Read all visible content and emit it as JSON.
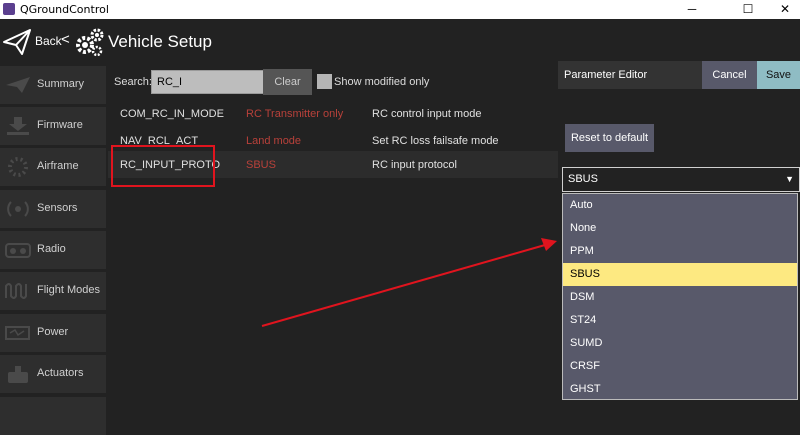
{
  "window": {
    "title": "QGroundControl",
    "controls": [
      "─",
      "☐",
      "✕"
    ]
  },
  "toolbar": {
    "back_label": "Back",
    "separator": "<",
    "title": "Vehicle Setup"
  },
  "sidebar": {
    "items": [
      {
        "label": "Summary",
        "icon": "plane-icon"
      },
      {
        "label": "Firmware",
        "icon": "download-icon"
      },
      {
        "label": "Airframe",
        "icon": "airframe-icon"
      },
      {
        "label": "Sensors",
        "icon": "sensors-icon"
      },
      {
        "label": "Radio",
        "icon": "radio-icon"
      },
      {
        "label": "Flight Modes",
        "icon": "flight-modes-icon"
      },
      {
        "label": "Power",
        "icon": "power-icon"
      },
      {
        "label": "Actuators",
        "icon": "actuators-icon"
      }
    ]
  },
  "search": {
    "label": "Search:",
    "value": "RC_I",
    "clear_label": "Clear",
    "show_modified_label": "Show modified only"
  },
  "params": [
    {
      "name": "COM_RC_IN_MODE",
      "value": "RC Transmitter only",
      "description": "RC control input mode"
    },
    {
      "name": "NAV_RCL_ACT",
      "value": "Land mode",
      "description": "Set RC loss failsafe mode"
    },
    {
      "name": "RC_INPUT_PROTO",
      "value": "SBUS",
      "description": "RC input protocol"
    }
  ],
  "editor": {
    "title": "Parameter Editor",
    "cancel_label": "Cancel",
    "save_label": "Save",
    "reset_label": "Reset to default",
    "selected": "SBUS",
    "caret": "▼",
    "options": [
      "Auto",
      "None",
      "PPM",
      "SBUS",
      "DSM",
      "ST24",
      "SUMD",
      "CRSF",
      "GHST"
    ]
  },
  "colors": {
    "accent_save": "#8fbcc4",
    "selected_option": "#fde981",
    "param_value": "#b8413a",
    "annotation_red": "#e0141e"
  }
}
